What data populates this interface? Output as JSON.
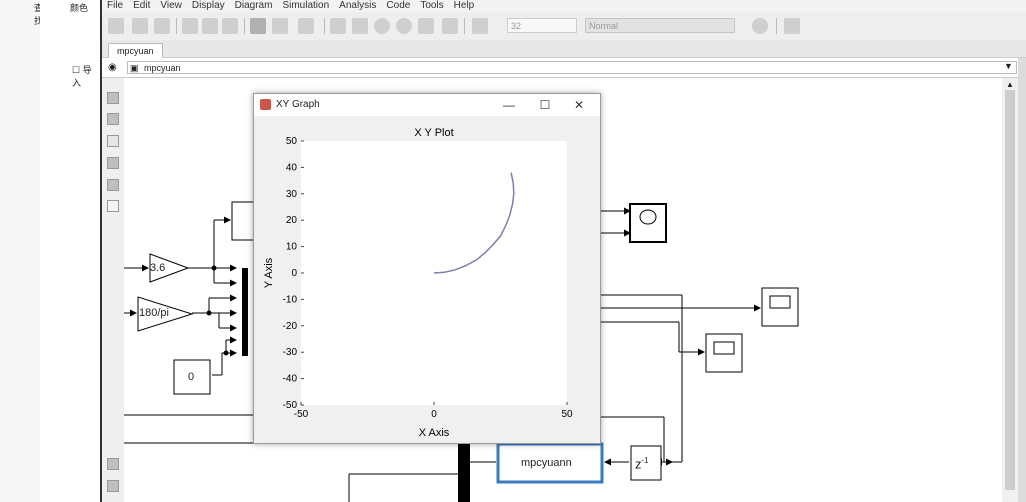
{
  "left_panel": {
    "item1": "查找",
    "item2": "颜色",
    "item3": "导入"
  },
  "menubar": {
    "items": [
      "File",
      "Edit",
      "View",
      "Display",
      "Diagram",
      "Simulation",
      "Analysis",
      "Code",
      "Tools",
      "Help"
    ]
  },
  "toolbar": {
    "stop_time": "32",
    "sim_mode": "Normal"
  },
  "tab": {
    "label": "mpcyuan"
  },
  "breadcrumb": {
    "path": "mpcyuan"
  },
  "blocks": {
    "gain1": "3.6",
    "gain2": "180/pi",
    "const": "0",
    "subsystem": "mpcyuann",
    "delay_base": "z",
    "delay_exp": "-1"
  },
  "xy_window": {
    "title": "XY Graph"
  },
  "chart_data": {
    "type": "line",
    "title": "X Y Plot",
    "xlabel": "X Axis",
    "ylabel": "Y Axis",
    "xlim": [
      -50,
      50
    ],
    "ylim": [
      -50,
      50
    ],
    "x_ticks": [
      -50,
      0,
      50
    ],
    "y_ticks": [
      50,
      40,
      30,
      20,
      10,
      0,
      -10,
      -20,
      -30,
      -40,
      -50
    ],
    "grid": false,
    "series": [
      {
        "color": "#7b7fb0",
        "x": [
          0,
          4,
          8,
          12,
          16,
          19,
          22,
          25,
          27,
          28.5,
          29.5,
          30,
          29.8,
          29
        ],
        "y": [
          0,
          0.3,
          1.2,
          2.8,
          5,
          7.5,
          10.5,
          14,
          18,
          22,
          26,
          30,
          34,
          38
        ]
      }
    ]
  },
  "colors": {
    "selection": "#3a7bbf",
    "curve": "#7b7fb0",
    "window_border": "#9a9a9a"
  }
}
